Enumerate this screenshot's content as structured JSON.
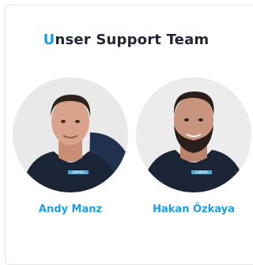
{
  "section": {
    "title_first_letter": "U",
    "title_rest": "nser Support Team"
  },
  "team": [
    {
      "name": "Andy Manz",
      "shirt_logo": "ZIMMER"
    },
    {
      "name": "Hakan Özkaya",
      "shirt_logo": "ZIMMER"
    }
  ],
  "colors": {
    "accent": "#1c9fe8",
    "title": "#1e2733",
    "shirt": "#1b2536"
  }
}
